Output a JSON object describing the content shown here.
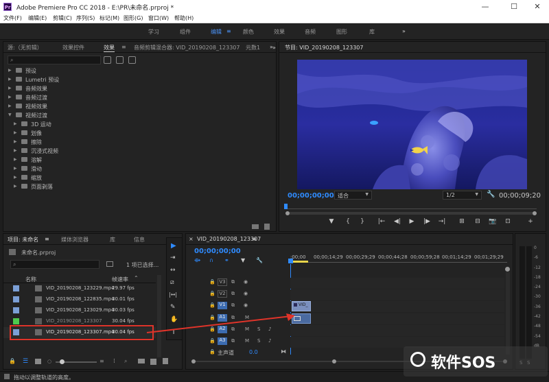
{
  "window": {
    "title": "Adobe Premiere Pro CC 2018 - E:\\PR\\未命名.prproj *",
    "app_icon": "Pr",
    "minimize": "—",
    "maximize": "☐",
    "close": "✕"
  },
  "menu": [
    "文件(F)",
    "编辑(E)",
    "剪辑(C)",
    "序列(S)",
    "标记(M)",
    "图形(G)",
    "窗口(W)",
    "帮助(H)"
  ],
  "workspaces": {
    "items": [
      "学习",
      "组件",
      "编辑",
      "颜色",
      "效果",
      "音频",
      "图形",
      "库"
    ],
    "active": "编辑",
    "more": "»",
    "menu_icon": "≡"
  },
  "effects_panel": {
    "tabs": [
      "源:（无剪辑）",
      "效果控件",
      "效果",
      "音频剪辑混合器: VID_20190208_123307",
      "元数1"
    ],
    "active_tab": "效果",
    "more": "»",
    "tree": [
      {
        "label": "预设",
        "level": 0,
        "open": false
      },
      {
        "label": "Lumetri 预设",
        "level": 0,
        "open": false
      },
      {
        "label": "音频效果",
        "level": 0,
        "open": false
      },
      {
        "label": "音频过渡",
        "level": 0,
        "open": false
      },
      {
        "label": "视频效果",
        "level": 0,
        "open": false
      },
      {
        "label": "视频过渡",
        "level": 0,
        "open": true
      },
      {
        "label": "3D 运动",
        "level": 1,
        "open": false
      },
      {
        "label": "划像",
        "level": 1,
        "open": false
      },
      {
        "label": "擦除",
        "level": 1,
        "open": false
      },
      {
        "label": "沉浸式视频",
        "level": 1,
        "open": false
      },
      {
        "label": "溶解",
        "level": 1,
        "open": false
      },
      {
        "label": "滑动",
        "level": 1,
        "open": false
      },
      {
        "label": "缩放",
        "level": 1,
        "open": false
      },
      {
        "label": "页面剥落",
        "level": 1,
        "open": false
      }
    ]
  },
  "program_monitor": {
    "tab": "节目: VID_20190208_123307",
    "menu_icon": "≡",
    "more": "»",
    "timecode_left": "00;00;00;00",
    "fit": "适合",
    "resolution": "1/2",
    "timecode_right": "00;00;09;20",
    "controls": [
      "▼",
      "{",
      "}",
      "|←",
      "◀|",
      "▶",
      "|▶",
      "→|",
      "⊞",
      "⊟",
      "📷",
      "⊡",
      "+"
    ]
  },
  "project_panel": {
    "tabs": [
      "项目: 未命名",
      "媒体浏览器",
      "库",
      "信息"
    ],
    "active_tab": "项目: 未命名",
    "more": "»",
    "project_file": "未命名.prproj",
    "selection_info": "1 项已选择...",
    "columns": {
      "name": "名称",
      "framerate": "帧速率"
    },
    "items": [
      {
        "name": "VID_20190208_123229.mp4",
        "fps": "29.97 fps",
        "color": "#7b9fd6",
        "selected": false
      },
      {
        "name": "VID_20190208_122835.mp4",
        "fps": "30.01 fps",
        "color": "#7b9fd6",
        "selected": false
      },
      {
        "name": "VID_20190208_123029.mp4",
        "fps": "30.03 fps",
        "color": "#7b9fd6",
        "selected": false
      },
      {
        "name": "VID_20190208_123307",
        "fps": "30.04 fps",
        "color": "#4ec94e",
        "selected": false,
        "sequence": true
      },
      {
        "name": "VID_20190208_123307.mp4",
        "fps": "30.04 fps",
        "color": "#7b9fd6",
        "selected": true
      }
    ]
  },
  "timeline": {
    "tab": "VID_20190208_123307",
    "menu_icon": "≡",
    "timecode": "00;00;00;00",
    "ruler": [
      ":00;00",
      "00;00;14;29",
      "00;00;29;29",
      "00;00;44;28",
      "00;00;59;28",
      "00;01;14;29",
      "00;01;29;29"
    ],
    "video_tracks": [
      "V3",
      "V2",
      "V1"
    ],
    "audio_tracks": [
      "A1",
      "A2",
      "A3"
    ],
    "master": "主声道",
    "master_value": "0.0",
    "clip_label": "VID_",
    "track_ctrl": {
      "lock": "🔒",
      "film": "▭",
      "eye": "👁",
      "m": "M",
      "s": "S",
      "mic": "🎤"
    }
  },
  "tools": [
    "▶",
    "⇥",
    "↔",
    "⧄",
    "|↔|",
    "✎",
    "✋",
    "T"
  ],
  "meter": {
    "labels": [
      "0",
      "-6",
      "-12",
      "-18",
      "-24",
      "-30",
      "-36",
      "-42",
      "-48",
      "-54",
      "dB"
    ],
    "buttons": [
      "S",
      "S"
    ]
  },
  "status_bar": {
    "text": "拖动以调整轨道的高度。"
  },
  "watermark": {
    "text": "软件SOS"
  },
  "colors": {
    "accent": "#2f8bff",
    "highlight_red": "#e0342a",
    "clip": "#3c6cb1"
  }
}
